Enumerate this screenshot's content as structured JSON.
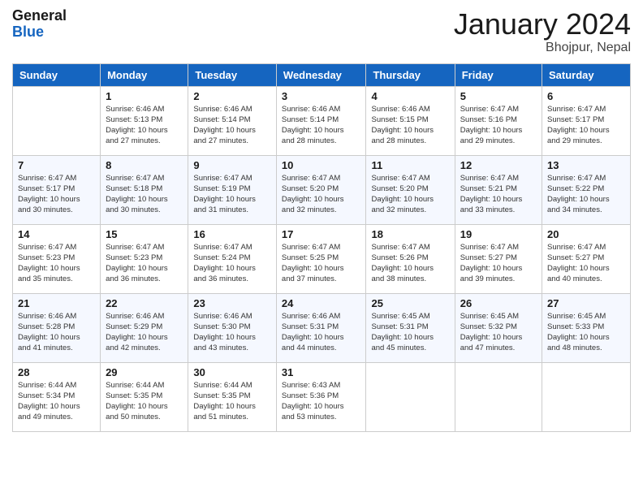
{
  "header": {
    "logo_line1": "General",
    "logo_line2": "Blue",
    "month_year": "January 2024",
    "location": "Bhojpur, Nepal"
  },
  "columns": [
    "Sunday",
    "Monday",
    "Tuesday",
    "Wednesday",
    "Thursday",
    "Friday",
    "Saturday"
  ],
  "weeks": [
    [
      {
        "num": "",
        "info": ""
      },
      {
        "num": "1",
        "info": "Sunrise: 6:46 AM\nSunset: 5:13 PM\nDaylight: 10 hours\nand 27 minutes."
      },
      {
        "num": "2",
        "info": "Sunrise: 6:46 AM\nSunset: 5:14 PM\nDaylight: 10 hours\nand 27 minutes."
      },
      {
        "num": "3",
        "info": "Sunrise: 6:46 AM\nSunset: 5:14 PM\nDaylight: 10 hours\nand 28 minutes."
      },
      {
        "num": "4",
        "info": "Sunrise: 6:46 AM\nSunset: 5:15 PM\nDaylight: 10 hours\nand 28 minutes."
      },
      {
        "num": "5",
        "info": "Sunrise: 6:47 AM\nSunset: 5:16 PM\nDaylight: 10 hours\nand 29 minutes."
      },
      {
        "num": "6",
        "info": "Sunrise: 6:47 AM\nSunset: 5:17 PM\nDaylight: 10 hours\nand 29 minutes."
      }
    ],
    [
      {
        "num": "7",
        "info": "Sunrise: 6:47 AM\nSunset: 5:17 PM\nDaylight: 10 hours\nand 30 minutes."
      },
      {
        "num": "8",
        "info": "Sunrise: 6:47 AM\nSunset: 5:18 PM\nDaylight: 10 hours\nand 30 minutes."
      },
      {
        "num": "9",
        "info": "Sunrise: 6:47 AM\nSunset: 5:19 PM\nDaylight: 10 hours\nand 31 minutes."
      },
      {
        "num": "10",
        "info": "Sunrise: 6:47 AM\nSunset: 5:20 PM\nDaylight: 10 hours\nand 32 minutes."
      },
      {
        "num": "11",
        "info": "Sunrise: 6:47 AM\nSunset: 5:20 PM\nDaylight: 10 hours\nand 32 minutes."
      },
      {
        "num": "12",
        "info": "Sunrise: 6:47 AM\nSunset: 5:21 PM\nDaylight: 10 hours\nand 33 minutes."
      },
      {
        "num": "13",
        "info": "Sunrise: 6:47 AM\nSunset: 5:22 PM\nDaylight: 10 hours\nand 34 minutes."
      }
    ],
    [
      {
        "num": "14",
        "info": "Sunrise: 6:47 AM\nSunset: 5:23 PM\nDaylight: 10 hours\nand 35 minutes."
      },
      {
        "num": "15",
        "info": "Sunrise: 6:47 AM\nSunset: 5:23 PM\nDaylight: 10 hours\nand 36 minutes."
      },
      {
        "num": "16",
        "info": "Sunrise: 6:47 AM\nSunset: 5:24 PM\nDaylight: 10 hours\nand 36 minutes."
      },
      {
        "num": "17",
        "info": "Sunrise: 6:47 AM\nSunset: 5:25 PM\nDaylight: 10 hours\nand 37 minutes."
      },
      {
        "num": "18",
        "info": "Sunrise: 6:47 AM\nSunset: 5:26 PM\nDaylight: 10 hours\nand 38 minutes."
      },
      {
        "num": "19",
        "info": "Sunrise: 6:47 AM\nSunset: 5:27 PM\nDaylight: 10 hours\nand 39 minutes."
      },
      {
        "num": "20",
        "info": "Sunrise: 6:47 AM\nSunset: 5:27 PM\nDaylight: 10 hours\nand 40 minutes."
      }
    ],
    [
      {
        "num": "21",
        "info": "Sunrise: 6:46 AM\nSunset: 5:28 PM\nDaylight: 10 hours\nand 41 minutes."
      },
      {
        "num": "22",
        "info": "Sunrise: 6:46 AM\nSunset: 5:29 PM\nDaylight: 10 hours\nand 42 minutes."
      },
      {
        "num": "23",
        "info": "Sunrise: 6:46 AM\nSunset: 5:30 PM\nDaylight: 10 hours\nand 43 minutes."
      },
      {
        "num": "24",
        "info": "Sunrise: 6:46 AM\nSunset: 5:31 PM\nDaylight: 10 hours\nand 44 minutes."
      },
      {
        "num": "25",
        "info": "Sunrise: 6:45 AM\nSunset: 5:31 PM\nDaylight: 10 hours\nand 45 minutes."
      },
      {
        "num": "26",
        "info": "Sunrise: 6:45 AM\nSunset: 5:32 PM\nDaylight: 10 hours\nand 47 minutes."
      },
      {
        "num": "27",
        "info": "Sunrise: 6:45 AM\nSunset: 5:33 PM\nDaylight: 10 hours\nand 48 minutes."
      }
    ],
    [
      {
        "num": "28",
        "info": "Sunrise: 6:44 AM\nSunset: 5:34 PM\nDaylight: 10 hours\nand 49 minutes."
      },
      {
        "num": "29",
        "info": "Sunrise: 6:44 AM\nSunset: 5:35 PM\nDaylight: 10 hours\nand 50 minutes."
      },
      {
        "num": "30",
        "info": "Sunrise: 6:44 AM\nSunset: 5:35 PM\nDaylight: 10 hours\nand 51 minutes."
      },
      {
        "num": "31",
        "info": "Sunrise: 6:43 AM\nSunset: 5:36 PM\nDaylight: 10 hours\nand 53 minutes."
      },
      {
        "num": "",
        "info": ""
      },
      {
        "num": "",
        "info": ""
      },
      {
        "num": "",
        "info": ""
      }
    ]
  ]
}
